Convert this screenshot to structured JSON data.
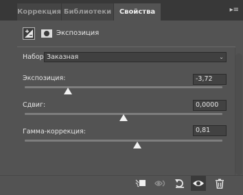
{
  "tabs": [
    {
      "label": "Коррекция",
      "active": false
    },
    {
      "label": "Библиотеки",
      "active": false
    },
    {
      "label": "Свойства",
      "active": true
    }
  ],
  "panel_menu_icon": "flyout-menu-icon",
  "header": {
    "adjustment_icon": "exposure-adjustment-icon",
    "mask_icon": "layer-mask-icon",
    "title": "Экспозиция"
  },
  "preset": {
    "label": "Набор:",
    "value": "Заказная"
  },
  "controls": [
    {
      "id": "exposure",
      "label": "Экспозиция:",
      "value": "-3,72",
      "slider_fraction": 0.22
    },
    {
      "id": "offset",
      "label": "Сдвиг:",
      "value": "0,0000",
      "slider_fraction": 0.5
    },
    {
      "id": "gamma",
      "label": "Гамма-коррекция:",
      "value": "0,81",
      "slider_fraction": 0.57
    }
  ],
  "footer_icons": [
    "clip-to-layer-icon",
    "view-previous-state-icon",
    "reset-icon",
    "visibility-eye-icon",
    "trash-icon"
  ],
  "colors": {
    "panel_bg": "#535353",
    "tabbar_bg": "#383838",
    "field_bg": "#424242",
    "slider_track": "#7e7e7e",
    "slider_thumb": "#f2f2f2"
  }
}
